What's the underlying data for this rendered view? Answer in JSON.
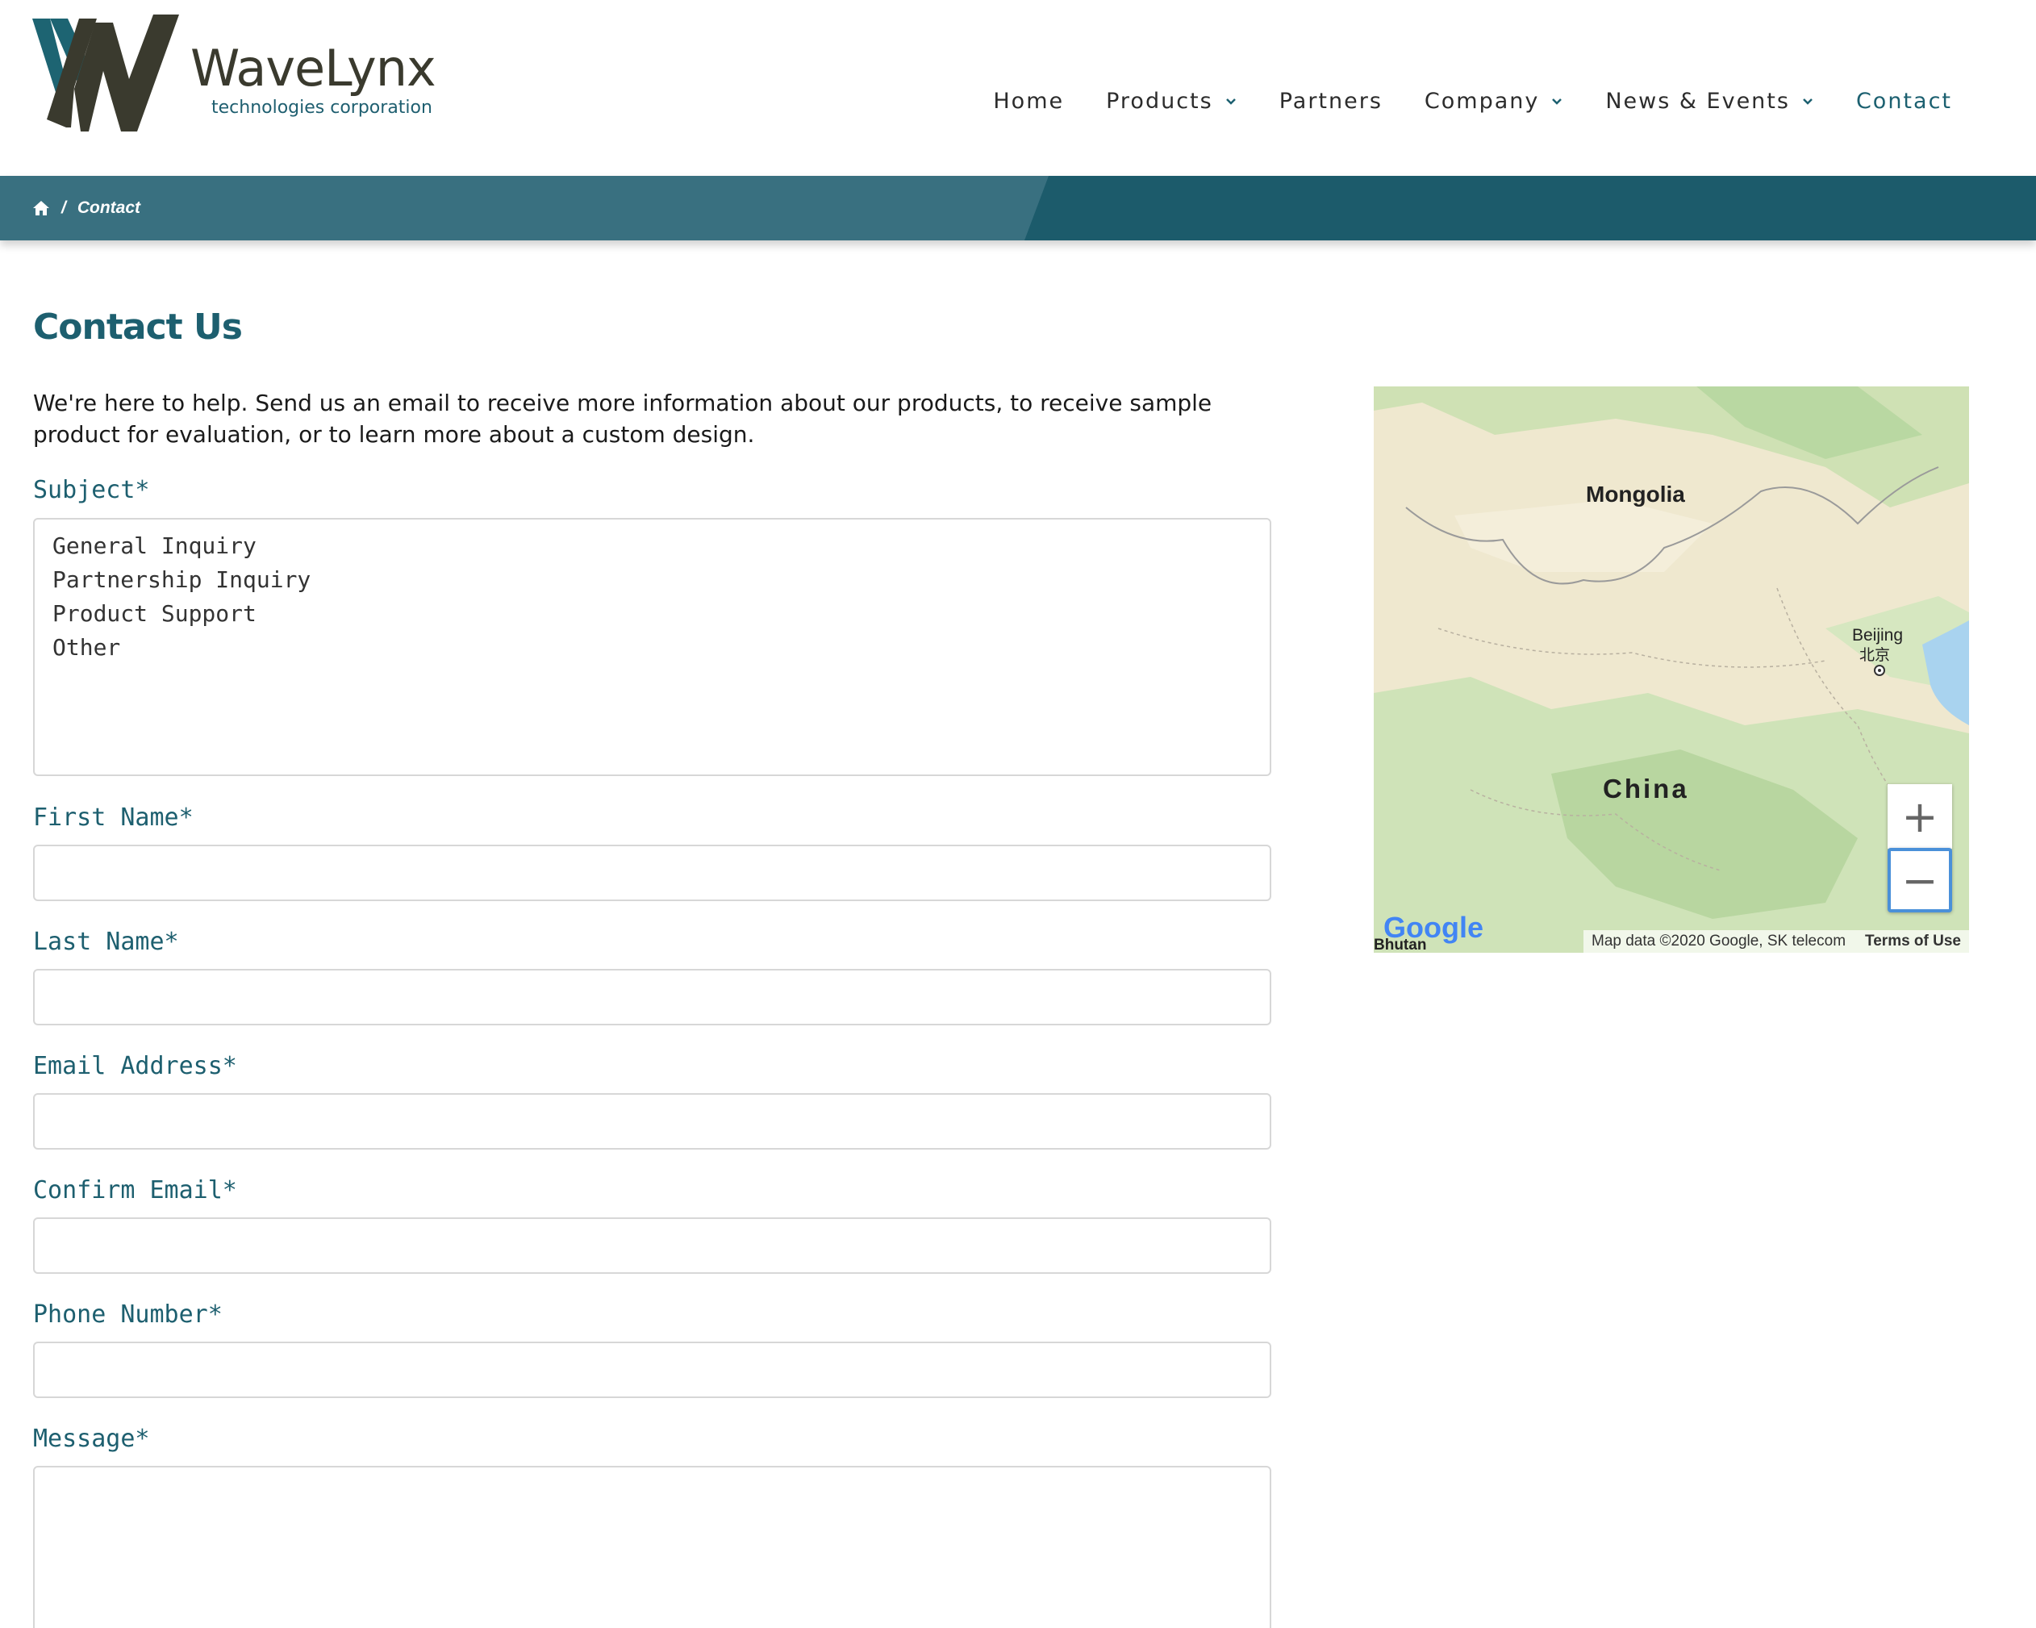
{
  "brand": {
    "name": "WaveLynx",
    "tagline": "technologies corporation"
  },
  "nav": {
    "items": [
      {
        "label": "Home",
        "dropdown": false
      },
      {
        "label": "Products",
        "dropdown": true
      },
      {
        "label": "Partners",
        "dropdown": false
      },
      {
        "label": "Company",
        "dropdown": true
      },
      {
        "label": "News & Events",
        "dropdown": true
      },
      {
        "label": "Contact",
        "dropdown": false,
        "active": true
      }
    ]
  },
  "breadcrumb": {
    "home_icon": "home-icon",
    "separator": "/",
    "current": "Contact"
  },
  "page": {
    "title": "Contact Us",
    "intro": "We're here to help. Send us an email to receive more information about our products, to receive sample product for evaluation, or to learn more about a custom design."
  },
  "form": {
    "subject": {
      "label": "Subject*",
      "options": [
        "General Inquiry",
        "Partnership Inquiry",
        "Product Support",
        "Other"
      ]
    },
    "first_name": {
      "label": "First Name*",
      "value": ""
    },
    "last_name": {
      "label": "Last Name*",
      "value": ""
    },
    "email": {
      "label": "Email Address*",
      "value": ""
    },
    "confirm_email": {
      "label": "Confirm Email*",
      "value": ""
    },
    "phone": {
      "label": "Phone Number*",
      "value": ""
    },
    "message": {
      "label": "Message*",
      "value": ""
    }
  },
  "map": {
    "labels": {
      "mongolia": "Mongolia",
      "beijing_en": "Beijing",
      "beijing_zh": "北京",
      "china": "China",
      "bhutan": "Bhutan"
    },
    "zoom_in": "+",
    "zoom_out": "−",
    "google": "Google",
    "attribution": "Map data ©2020 Google, SK telecom",
    "terms": "Terms of Use"
  },
  "colors": {
    "brand_teal": "#1c6070",
    "band_dark": "#1c5b6b",
    "band_light": "#397080",
    "logo_dark": "#3a3a2e"
  }
}
